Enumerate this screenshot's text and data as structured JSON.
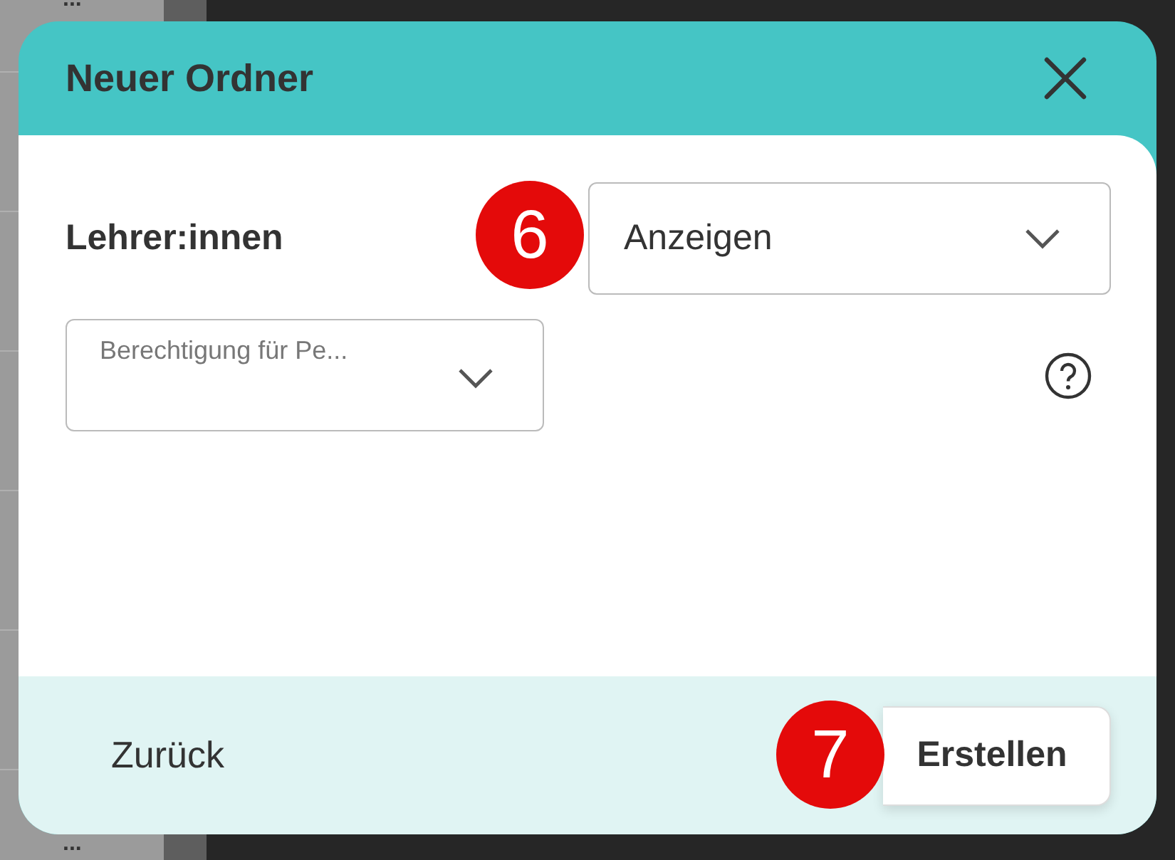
{
  "background": {
    "menu_dots": [
      "...",
      "..."
    ]
  },
  "dialog": {
    "title": "Neuer Ordner",
    "role_row": {
      "label": "Lehrer:innen",
      "select_value": "Anzeigen",
      "step_badge": "6"
    },
    "permission_select": {
      "placeholder": "Berechtigung für Pe..."
    },
    "back_button": "Zurück",
    "create_button": {
      "label": "Erstellen",
      "step_badge": "7"
    }
  }
}
